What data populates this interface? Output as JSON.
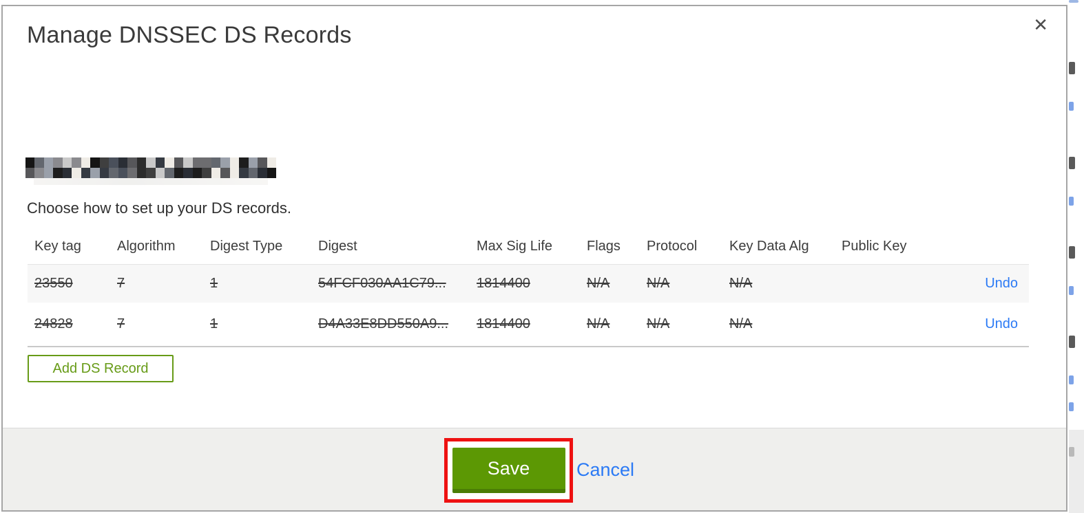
{
  "modal": {
    "title": "Manage DNSSEC DS Records",
    "close_icon": "✕",
    "domain": {
      "redacted": true
    },
    "subtitle": "Choose how to set up your DS records.",
    "table": {
      "headers": [
        "Key tag",
        "Algorithm",
        "Digest Type",
        "Digest",
        "Max Sig Life",
        "Flags",
        "Protocol",
        "Key Data Alg",
        "Public Key"
      ],
      "rows": [
        {
          "key_tag": "23550",
          "algorithm": "7",
          "digest_type": "1",
          "digest": "54FCF030AA1C79...",
          "max_sig_life": "1814400",
          "flags": "N/A",
          "protocol": "N/A",
          "key_data_alg": "N/A",
          "public_key": "",
          "action": "Undo",
          "marked_for_deletion": true
        },
        {
          "key_tag": "24828",
          "algorithm": "7",
          "digest_type": "1",
          "digest": "D4A33E8DD550A9...",
          "max_sig_life": "1814400",
          "flags": "N/A",
          "protocol": "N/A",
          "key_data_alg": "N/A",
          "public_key": "",
          "action": "Undo",
          "marked_for_deletion": true
        }
      ]
    },
    "add_button_label": "Add DS Record",
    "footer": {
      "save_label": "Save",
      "cancel_label": "Cancel"
    }
  },
  "annotation": {
    "shape": "red-rectangle-highlight",
    "target": "save-button",
    "color": "#ee1111"
  },
  "colors": {
    "link_blue": "#2b7af5",
    "annotation_red": "#ee1111",
    "save_green": "#5c9804",
    "save_green_dark": "#4b7d06",
    "add_green": "#679b17",
    "footer_bg": "#efefed",
    "row_alt_bg": "#f7f7f7",
    "title_text": "#3a3a3a"
  },
  "redaction": {
    "rows": 2,
    "cols": 27,
    "palette": [
      "#151515",
      "#2c2c2c",
      "#3f3f3f",
      "#57575a",
      "#6d6d70",
      "#8a8a8e",
      "#4a505b",
      "#353a42",
      "#9aa0aa",
      "#c9c9c9",
      "#efece6",
      "#1d1d1d",
      "#63676e",
      "#2a2e35"
    ]
  }
}
